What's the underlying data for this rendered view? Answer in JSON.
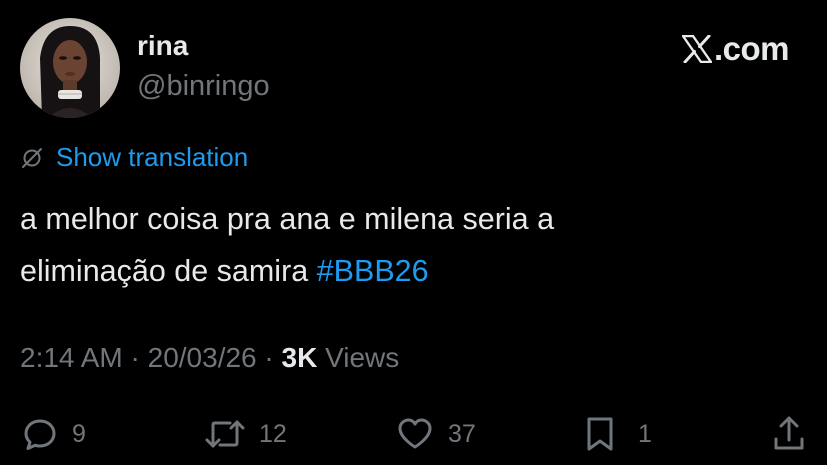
{
  "author": {
    "name": "rina",
    "handle": "@binringo",
    "avatar_icon": "profile-photo"
  },
  "brand": {
    "logo_icon": "x-logo-icon",
    "domain_suffix": ".com"
  },
  "translation": {
    "icon": "translate-icon",
    "label": "Show translation"
  },
  "tweet": {
    "line1": "a melhor coisa pra ana e milena seria a",
    "line2_prefix": "eliminação de samira ",
    "hashtag": "#BBB26"
  },
  "meta": {
    "time": "2:14 AM",
    "separator": " · ",
    "date": "20/03/26",
    "views_count": "3K",
    "views_label": " Views"
  },
  "actions": {
    "replies": "9",
    "reposts": "12",
    "likes": "37",
    "bookmarks": "1"
  },
  "colors": {
    "background": "#000000",
    "text": "#e7e9ea",
    "secondary": "#71767b",
    "accent": "#1d9bf0"
  }
}
